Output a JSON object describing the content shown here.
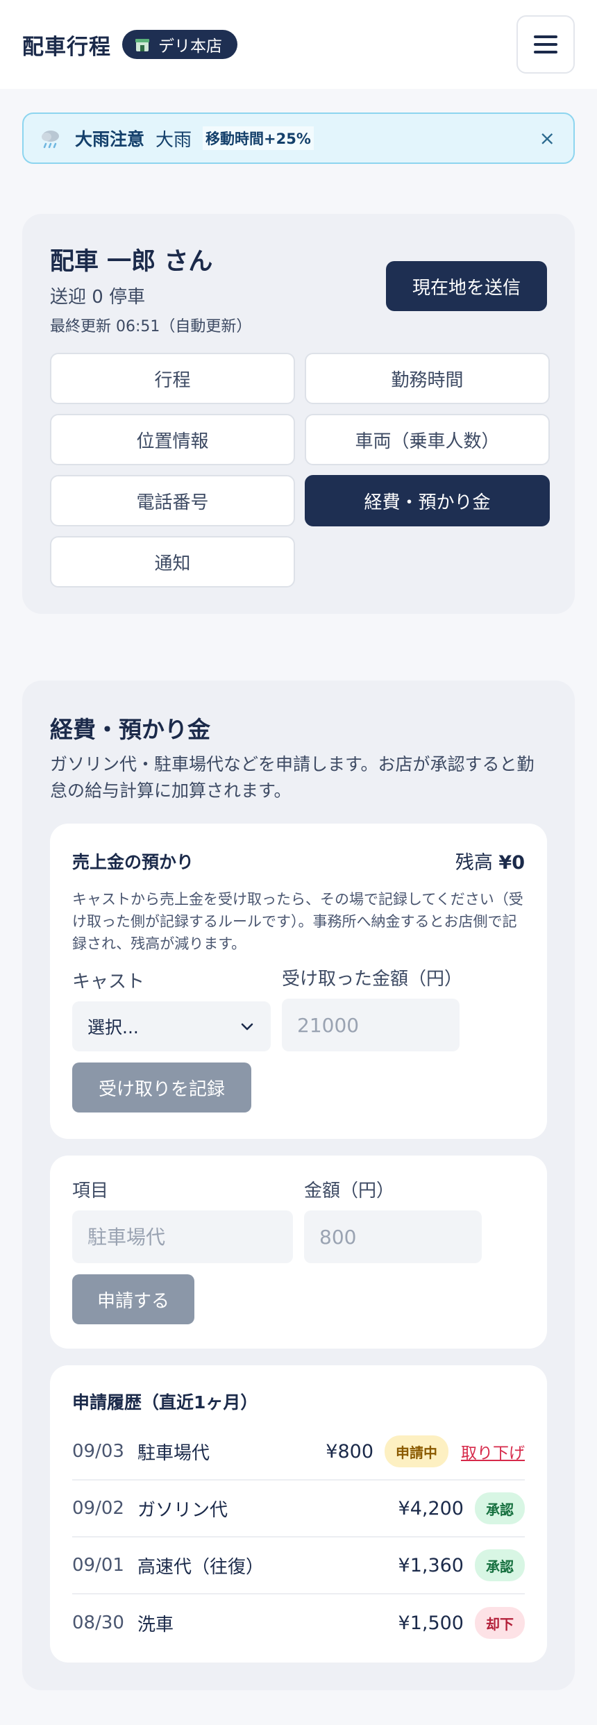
{
  "header": {
    "title": "配車行程",
    "store": "デリ本店"
  },
  "alert": {
    "title": "大雨注意",
    "text": "大雨",
    "tag": "移動時間+25%",
    "close": "×"
  },
  "driver": {
    "name": "配車 一郎 さん",
    "stops": "送迎 0 停車",
    "updated": "最終更新 06:51（自動更新）",
    "send_location": "現在地を送信"
  },
  "tabs": [
    {
      "label": "行程",
      "active": false
    },
    {
      "label": "勤務時間",
      "active": false
    },
    {
      "label": "位置情報",
      "active": false
    },
    {
      "label": "車両（乗車人数）",
      "active": false
    },
    {
      "label": "電話番号",
      "active": false
    },
    {
      "label": "経費・預かり金",
      "active": true
    },
    {
      "label": "通知",
      "active": false
    }
  ],
  "expense": {
    "title": "経費・預かり金",
    "desc": "ガソリン代・駐車場代などを申請します。お店が承認すると勤怠の給与計算に加算されます。"
  },
  "deposit": {
    "title": "売上金の預かり",
    "balance_label": "残高 ",
    "balance_amount": "¥0",
    "note": "キャストから売上金を受け取ったら、その場で記録してください（受け取った側が記録するルールです）。事務所へ納金するとお店側で記録され、残高が減ります。",
    "cast_label": "キャスト",
    "cast_value": "選択...",
    "amount_label": "受け取った金額（円）",
    "amount_placeholder": "21000",
    "record_button": "受け取りを記録"
  },
  "claim": {
    "item_label": "項目",
    "item_placeholder": "駐車場代",
    "amount_label": "金額（円）",
    "amount_placeholder": "800",
    "submit_button": "申請する"
  },
  "history": {
    "title": "申請履歴（直近1ヶ月）",
    "rows": [
      {
        "date": "09/03",
        "item": "駐車場代",
        "amount": "¥800",
        "status": "申請中",
        "status_type": "pending",
        "action": "取り下げ"
      },
      {
        "date": "09/02",
        "item": "ガソリン代",
        "amount": "¥4,200",
        "status": "承認",
        "status_type": "approved"
      },
      {
        "date": "09/01",
        "item": "高速代（往復）",
        "amount": "¥1,360",
        "status": "承認",
        "status_type": "approved"
      },
      {
        "date": "08/30",
        "item": "洗車",
        "amount": "¥1,500",
        "status": "却下",
        "status_type": "rejected"
      }
    ]
  },
  "colors": {
    "navy": "#1e2f52",
    "alert_bg": "#e3f5fc",
    "pending": "#fdf0c2",
    "approved": "#d8f6e4",
    "rejected": "#fde2e6"
  }
}
